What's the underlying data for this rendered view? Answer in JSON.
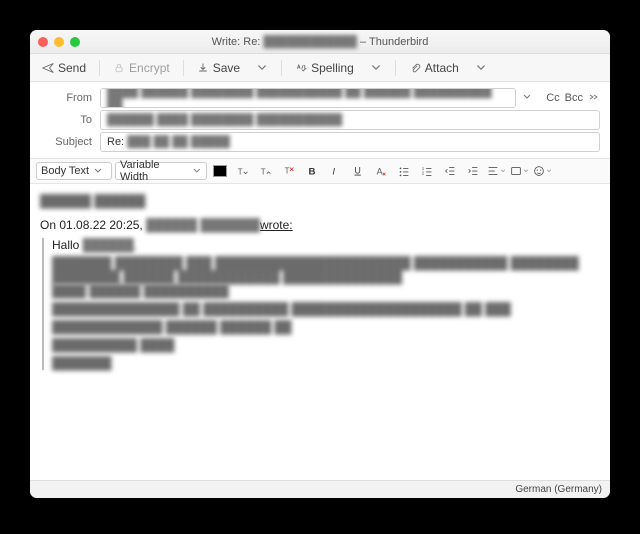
{
  "title_prefix": "Write: Re:",
  "title_blurred": "████████████",
  "title_suffix": " – Thunderbird",
  "toolbar": {
    "send": "Send",
    "encrypt": "Encrypt",
    "save": "Save",
    "spelling": "Spelling",
    "attach": "Attach"
  },
  "labels": {
    "from": "From",
    "to": "To",
    "subject": "Subject",
    "cc": "Cc",
    "bcc": "Bcc"
  },
  "from_blurred": "████ ██████ ████████ ███████████ ██ ██████ ██████████ ██",
  "to_blurred": "██████ ████ ████████ ███████████",
  "subject_prefix": "Re:",
  "subject_blurred": "███ ██ ██  █████",
  "format": {
    "block": "Body Text",
    "font": "Variable Width"
  },
  "body": {
    "greet": "██████ ██████",
    "quote_intro_a": "On 01.08.22 20:25, ",
    "quote_intro_name": "██████ ███████",
    "quote_intro_b": "wrote:",
    "hello_a": "Hallo ",
    "hello_b": "██████,",
    "l1": "███████ ████████ ███ ███████████████████████ ███████████ ████████ ████████ ██████ ████████████ ██████████████",
    "l1b": "████ ██████ ██████████",
    "l2": "███████████████ ██ ██████████ ████████████████████ ██ ███",
    "l3": "█████████████ ██████ ██████ ██",
    "l4": "██████████ ████",
    "l5": "███████"
  },
  "status": "German (Germany)"
}
